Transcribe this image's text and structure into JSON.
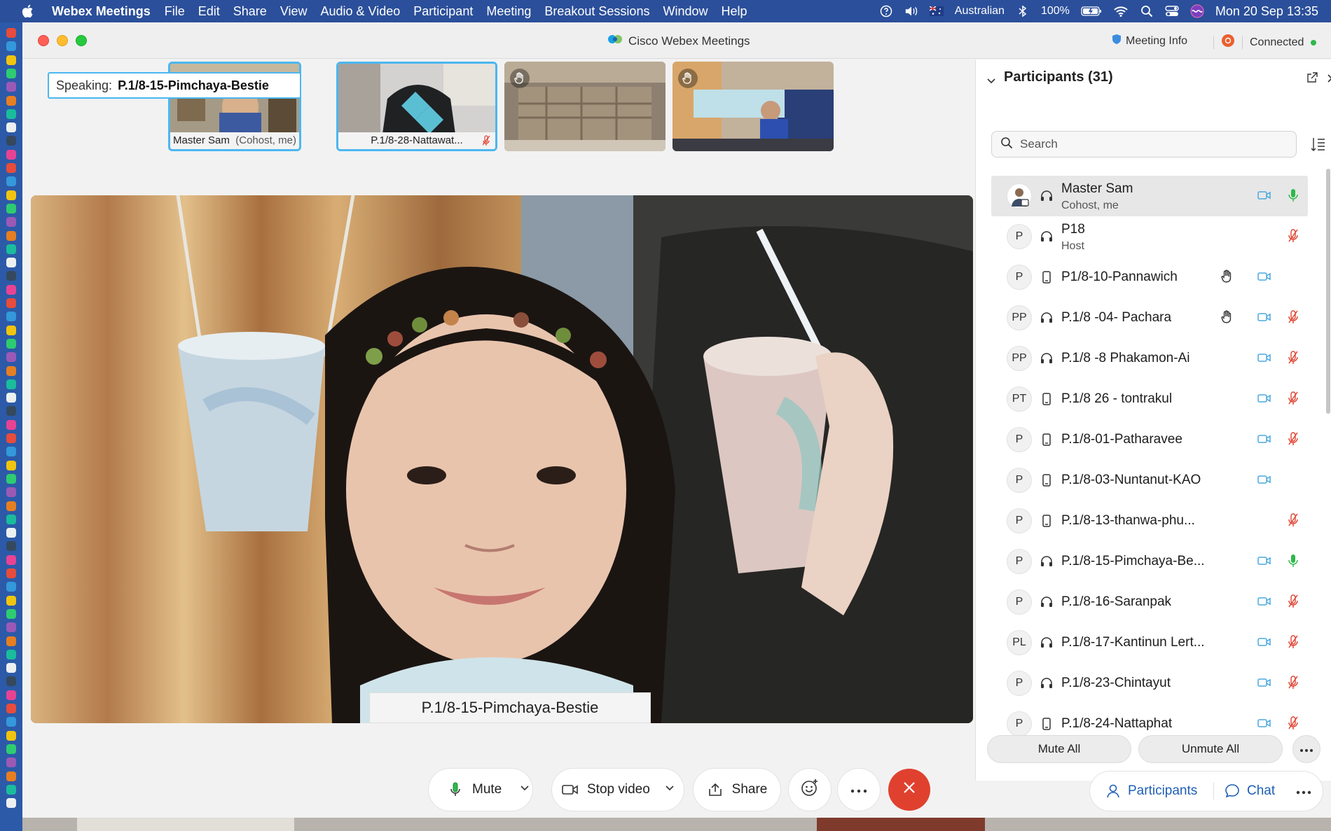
{
  "menubar": {
    "app_name": "Webex Meetings",
    "items": [
      "File",
      "Edit",
      "Share",
      "View",
      "Audio & Video",
      "Participant",
      "Meeting",
      "Breakout Sessions",
      "Window",
      "Help"
    ],
    "input_source": "Australian",
    "battery": "100%",
    "datetime": "Mon 20 Sep  13:35"
  },
  "window": {
    "title": "Cisco Webex Meetings",
    "meeting_info": "Meeting Info",
    "status": "Connected",
    "status_color": "#2fb84b"
  },
  "speaking": {
    "label": "Speaking:",
    "name": "P.1/8-15-Pimchaya-Bestie"
  },
  "thumbnails": [
    {
      "caption": "Master Sam",
      "caption_role": "(Cohost, me)"
    },
    {
      "caption": "P.1/8-28-Nattawat..."
    },
    {
      "caption": ""
    },
    {
      "caption": ""
    }
  ],
  "main_video": {
    "name_label": "P.1/8-15-Pimchaya-Bestie"
  },
  "controls": {
    "mute": "Mute",
    "stop_video": "Stop video",
    "share": "Share",
    "end_color": "#e0412f"
  },
  "participants_panel": {
    "title": "Participants (31)",
    "search_placeholder": "Search",
    "mute_all": "Mute All",
    "unmute_all": "Unmute All",
    "participants": [
      {
        "initials": "",
        "name": "Master Sam",
        "role": "Cohost, me",
        "device": "headset",
        "hand": false,
        "video": true,
        "mic": "on"
      },
      {
        "initials": "P",
        "name": "P18",
        "role": "Host",
        "device": "headset",
        "hand": false,
        "video": false,
        "mic": "muted"
      },
      {
        "initials": "P",
        "name": "P1/8-10-Pannawich",
        "role": "",
        "device": "phone",
        "hand": true,
        "video": true,
        "mic": "none"
      },
      {
        "initials": "PP",
        "name": "P.1/8 -04- Pachara",
        "role": "",
        "device": "headset",
        "hand": true,
        "video": true,
        "mic": "muted"
      },
      {
        "initials": "PP",
        "name": "P.1/8 -8 Phakamon-Ai",
        "role": "",
        "device": "headset",
        "hand": false,
        "video": true,
        "mic": "muted"
      },
      {
        "initials": "PT",
        "name": "P.1/8 26 - tontrakul",
        "role": "",
        "device": "phone",
        "hand": false,
        "video": true,
        "mic": "muted"
      },
      {
        "initials": "P",
        "name": "P.1/8-01-Patharavee",
        "role": "",
        "device": "phone",
        "hand": false,
        "video": true,
        "mic": "muted"
      },
      {
        "initials": "P",
        "name": "P.1/8-03-Nuntanut-KAO",
        "role": "",
        "device": "phone",
        "hand": false,
        "video": true,
        "mic": "none"
      },
      {
        "initials": "P",
        "name": "P.1/8-13-thanwa-phu...",
        "role": "",
        "device": "phone",
        "hand": false,
        "video": false,
        "mic": "muted"
      },
      {
        "initials": "P",
        "name": "P.1/8-15-Pimchaya-Be...",
        "role": "",
        "device": "headset",
        "hand": false,
        "video": true,
        "mic": "on"
      },
      {
        "initials": "P",
        "name": "P.1/8-16-Saranpak",
        "role": "",
        "device": "headset",
        "hand": false,
        "video": true,
        "mic": "muted"
      },
      {
        "initials": "PL",
        "name": "P.1/8-17-Kantinun Lert...",
        "role": "",
        "device": "headset",
        "hand": false,
        "video": true,
        "mic": "muted"
      },
      {
        "initials": "P",
        "name": "P.1/8-23-Chintayut",
        "role": "",
        "device": "headset",
        "hand": false,
        "video": true,
        "mic": "muted"
      },
      {
        "initials": "P",
        "name": "P.1/8-24-Nattaphat",
        "role": "",
        "device": "phone",
        "hand": false,
        "video": true,
        "mic": "muted"
      }
    ]
  },
  "bottom_tabs": {
    "participants": "Participants",
    "chat": "Chat"
  },
  "colors": {
    "accent": "#1f5fb5",
    "muted_red": "#e0412f",
    "mic_green": "#2fb84b",
    "video_blue": "#4aa8e0",
    "menubar": "#2b4f9a"
  }
}
